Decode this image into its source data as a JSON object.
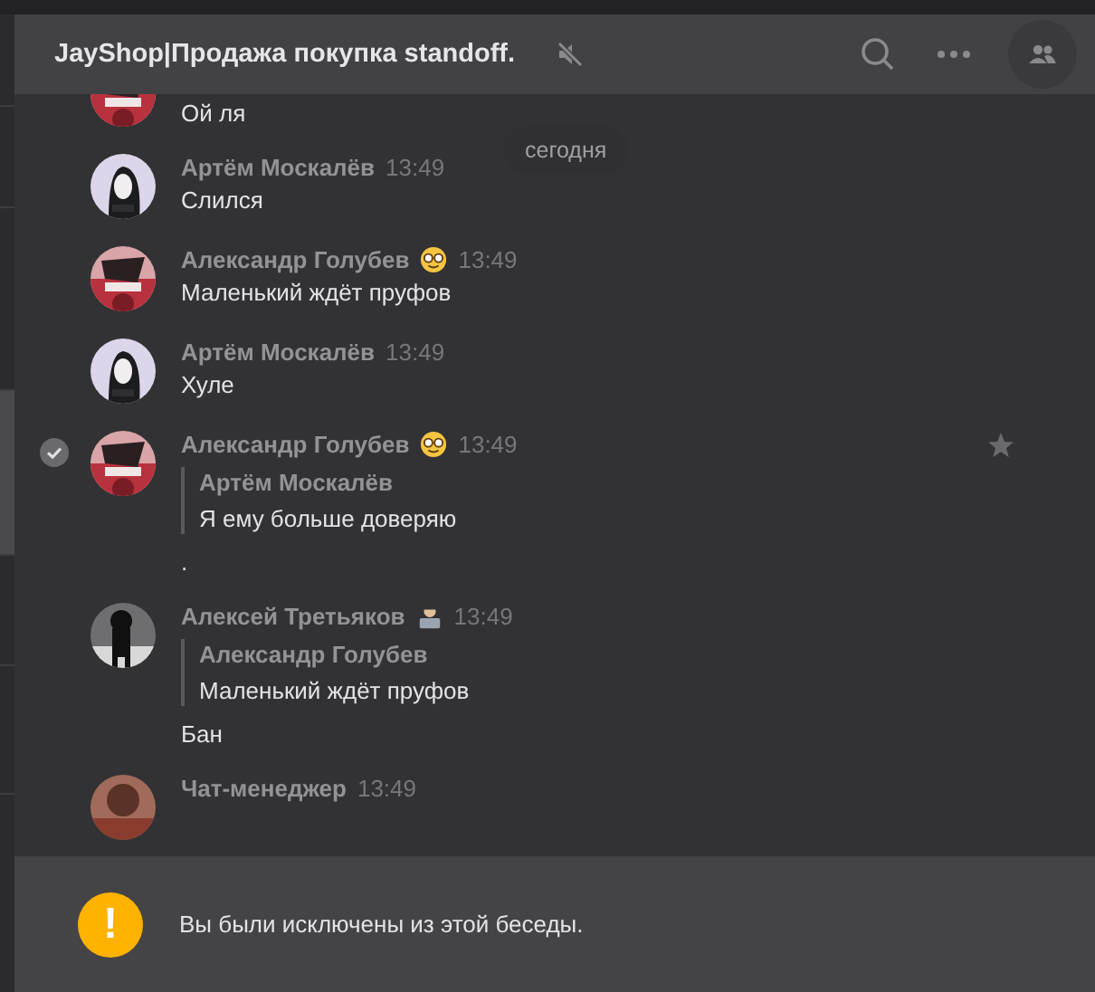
{
  "header": {
    "title": "JayShop|Продажа покупка standoff.",
    "muted": true
  },
  "date_pill": "сегодня",
  "messages": [
    {
      "kind": "continuation",
      "text": "Ой ля",
      "selected": false
    },
    {
      "kind": "message",
      "author": "Артём Москалёв",
      "time": "13:49",
      "text": "Слился",
      "selected": false
    },
    {
      "kind": "message",
      "author": "Александр Голубев",
      "badge": {
        "kind": "nerd"
      },
      "time": "13:49",
      "text": "Маленький ждёт пруфов",
      "selected": false
    },
    {
      "kind": "message",
      "author": "Артём Москалёв",
      "time": "13:49",
      "text": "Хуле",
      "selected": false
    },
    {
      "kind": "message",
      "author": "Александр Голубев",
      "badge": {
        "kind": "nerd"
      },
      "time": "13:49",
      "quote": {
        "author": "Артём Москалёв",
        "text": "Я ему больше доверяю"
      },
      "text": ".",
      "selected": true
    },
    {
      "kind": "message",
      "author": "Алексей Третьяков",
      "badge": {
        "kind": "coder"
      },
      "time": "13:49",
      "quote": {
        "author": "Александр Голубев",
        "text": "Маленький ждёт пруфов"
      },
      "text": "Бан",
      "selected": false
    },
    {
      "kind": "message",
      "author": "Чат-менеджер",
      "time": "13:49",
      "selected": false
    }
  ],
  "notice": {
    "text": "Вы были исключены из этой беседы.",
    "icon": "!"
  }
}
